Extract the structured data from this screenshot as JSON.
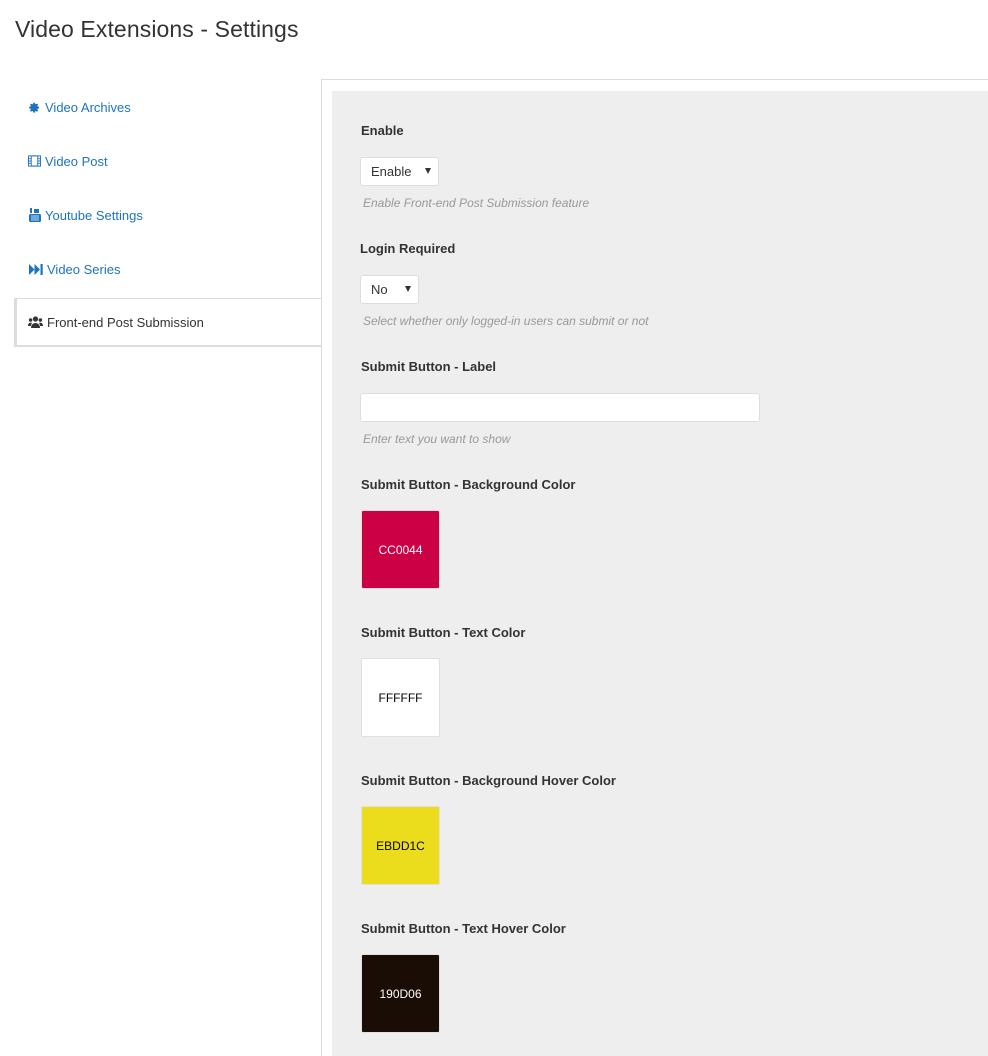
{
  "page": {
    "title": "Video Extensions - Settings"
  },
  "sidebar": {
    "items": [
      {
        "label": "Video Archives",
        "icon": "gear-icon"
      },
      {
        "label": "Video Post",
        "icon": "film-icon"
      },
      {
        "label": "Youtube Settings",
        "icon": "youtube-icon"
      },
      {
        "label": "Video Series",
        "icon": "fast-forward-icon"
      },
      {
        "label": "Front-end Post Submission",
        "icon": "users-icon",
        "active": true
      }
    ]
  },
  "form": {
    "enable": {
      "label": "Enable",
      "value": "Enable",
      "help": "Enable Front-end Post Submission feature"
    },
    "login_required": {
      "label": "Login Required",
      "value": "No",
      "help": "Select whether only logged-in users can submit or not"
    },
    "submit_label": {
      "label": "Submit Button - Label",
      "value": "",
      "placeholder": "",
      "help": "Enter text you want to show"
    },
    "bg_color": {
      "label": "Submit Button - Background Color",
      "value": "CC0044",
      "color": "#CC0044",
      "text_color": "#ffffff"
    },
    "text_color": {
      "label": "Submit Button - Text Color",
      "value": "FFFFFF",
      "color": "#FFFFFF",
      "text_color": "#000000"
    },
    "bg_hover_color": {
      "label": "Submit Button - Background Hover Color",
      "value": "EBDD1C",
      "color": "#EBDD1C",
      "text_color": "#000000"
    },
    "text_hover_color": {
      "label": "Submit Button - Text Hover Color",
      "value": "190D06",
      "color": "#190D06",
      "text_color": "#ffffff"
    }
  },
  "colors": {
    "link": "#1e73be",
    "panel_bg": "#eeeeee"
  }
}
